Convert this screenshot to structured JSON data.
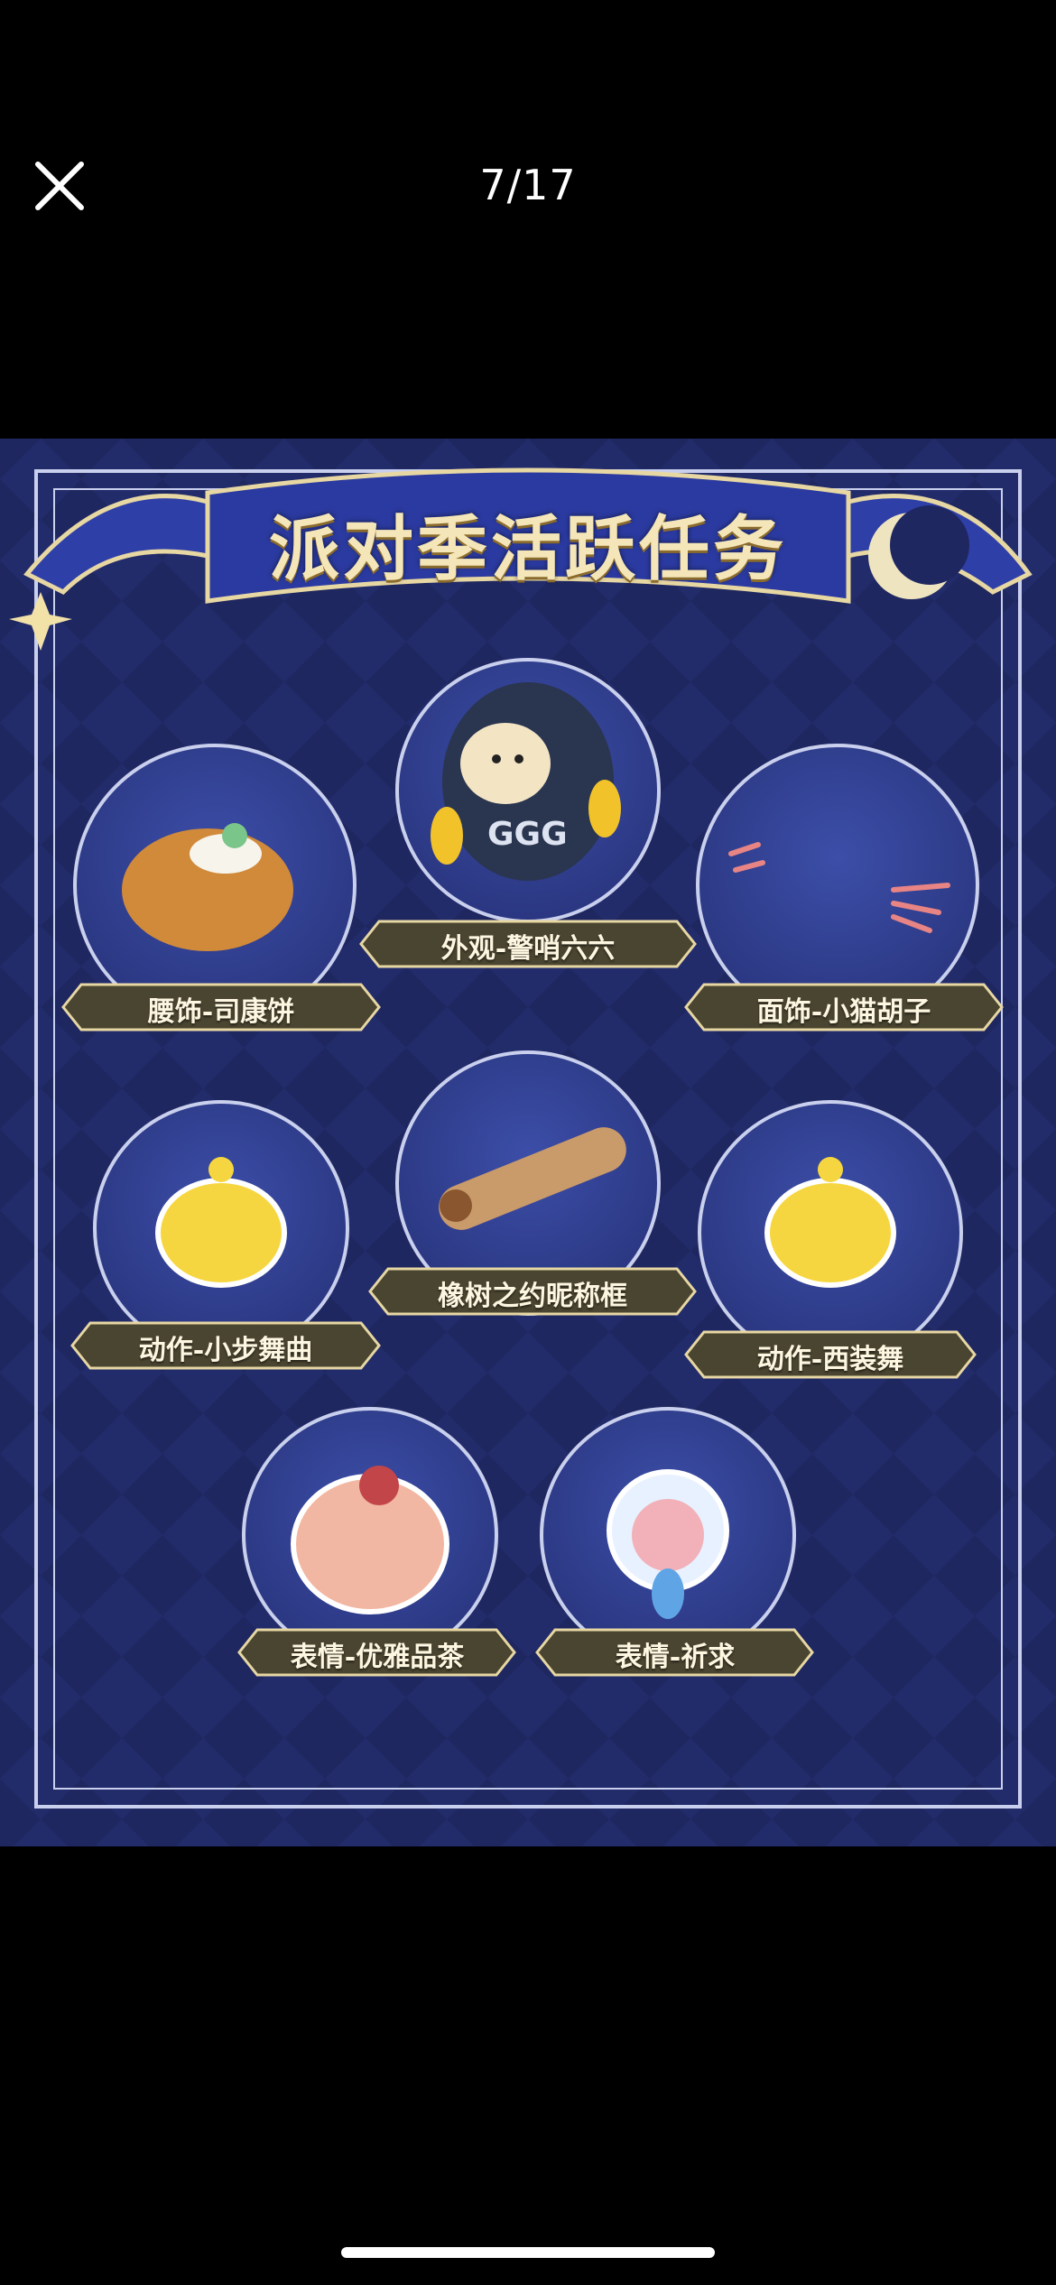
{
  "header": {
    "counter": "7/17"
  },
  "poster": {
    "title": "派对季活跃任务",
    "items": [
      {
        "label": "外观-警哨六六"
      },
      {
        "label": "腰饰-司康饼"
      },
      {
        "label": "面饰-小猫胡子"
      },
      {
        "label": "橡树之约昵称框"
      },
      {
        "label": "动作-小步舞曲"
      },
      {
        "label": "动作-西装舞"
      },
      {
        "label": "表情-优雅品茶"
      },
      {
        "label": "表情-祈求"
      }
    ]
  },
  "colors": {
    "poster_bg": "#1c2358",
    "frame": "#c9d0ee",
    "ribbon": "#2f3fa8",
    "ribbon_edge": "#e7d7a3",
    "label_bg": "#4a4530",
    "label_text": "#fdf6e0"
  }
}
